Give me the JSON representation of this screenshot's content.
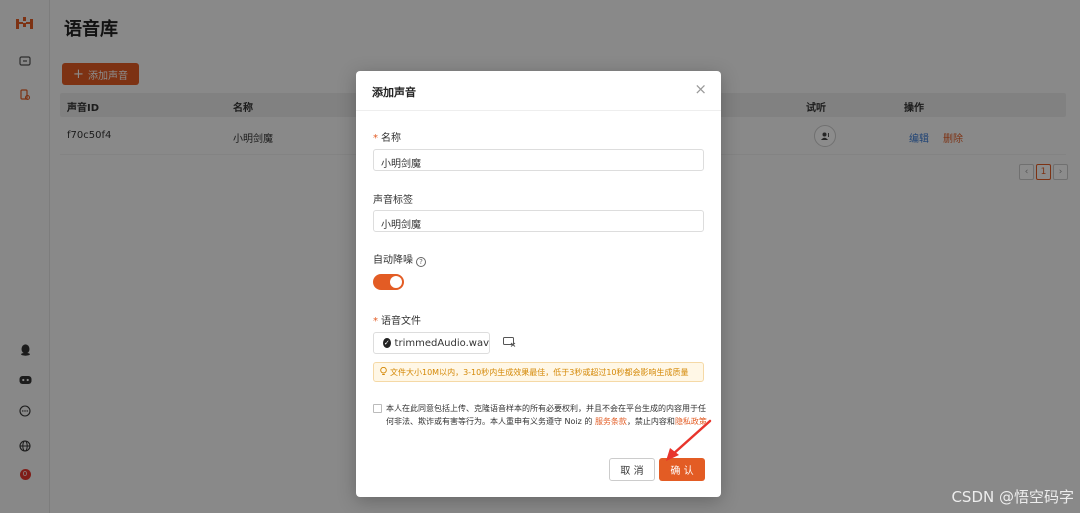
{
  "sidebar": {
    "icons": [
      "logo-icon",
      "voice-library-icon",
      "voice-clone-icon",
      "qq-icon",
      "discord-icon",
      "chat-icon",
      "globe-icon",
      "notification-badge-icon"
    ],
    "badge": "0"
  },
  "main": {
    "title": "语音库",
    "add_button": "添加声音",
    "table": {
      "headers": [
        "声音ID",
        "名称",
        "试听",
        "操作"
      ],
      "rows": [
        {
          "id": "f70c50f4",
          "name": "小明剑魔",
          "actions": [
            "编辑",
            "删除"
          ]
        }
      ]
    },
    "pagination": {
      "prev": "‹",
      "page": "1",
      "next": "›"
    }
  },
  "modal": {
    "title": "添加声音",
    "close": "×",
    "name_label": "名称",
    "name_value": "小明剑魔",
    "tag_label": "声音标签",
    "tag_value": "小明剑魔",
    "denoise_label": "自动降噪",
    "denoise_on": true,
    "file_label": "语音文件",
    "file_name": "trimmedAudio.wav",
    "warning": "文件大小10M以内，3-10秒内生成效果最佳，低于3秒或超过10秒都会影响生成质量",
    "consent_text_1": "本人在此同意包括上传、克隆语音样本的所有必要权利，并且不会在平台生成的内容用于任何非法、欺诈或有害等行为。本人重申有义务遵守 Noiz 的 ",
    "consent_link_1": "服务条款",
    "consent_text_2": "，禁止内容和",
    "consent_link_2": "隐私政策",
    "cancel": "取 消",
    "confirm": "确 认"
  },
  "colors": {
    "accent": "#e35c24",
    "arrow": "#e8352c"
  },
  "watermark": "CSDN @悟空码字"
}
